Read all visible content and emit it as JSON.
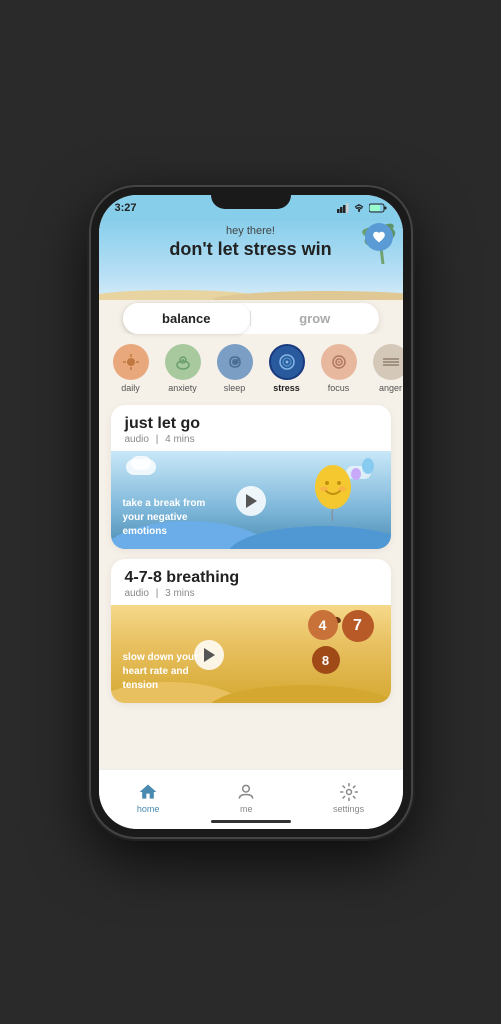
{
  "statusBar": {
    "time": "3:27",
    "signal": "▲▲",
    "wifi": "wifi",
    "battery": "battery"
  },
  "header": {
    "greeting": "hey there!",
    "title": "don't let stress win"
  },
  "tabs": [
    {
      "id": "balance",
      "label": "balance",
      "active": true
    },
    {
      "id": "grow",
      "label": "grow",
      "active": false
    }
  ],
  "categories": [
    {
      "id": "daily",
      "label": "daily",
      "active": false,
      "color": "#e8a87c",
      "emoji": "☀️"
    },
    {
      "id": "anxiety",
      "label": "anxiety",
      "active": false,
      "color": "#a8c89e",
      "emoji": "🫧"
    },
    {
      "id": "sleep",
      "label": "sleep",
      "active": false,
      "color": "#7b9ec4",
      "emoji": "🌙"
    },
    {
      "id": "stress",
      "label": "stress",
      "active": true,
      "color": "#4a7ab5",
      "emoji": "🌀"
    },
    {
      "id": "focus",
      "label": "focus",
      "active": false,
      "color": "#e8b89e",
      "emoji": "🎯"
    },
    {
      "id": "anger",
      "label": "anger",
      "active": false,
      "color": "#d4c8b8",
      "emoji": "〰️"
    }
  ],
  "cards": [
    {
      "id": "just-let-go",
      "title": "just let go",
      "type": "audio",
      "duration": "4 mins",
      "imageText": "take a break from\nyour negative\nemotions",
      "imageTheme": "blue"
    },
    {
      "id": "breathing",
      "title": "4-7-8 breathing",
      "type": "audio",
      "duration": "3 mins",
      "imageText": "slow down your\nheart rate and\ntension",
      "imageTheme": "yellow",
      "numbers": [
        "4",
        "7",
        "8"
      ]
    }
  ],
  "navigation": [
    {
      "id": "home",
      "label": "home",
      "icon": "🏠",
      "active": true
    },
    {
      "id": "me",
      "label": "me",
      "icon": "👤",
      "active": false
    },
    {
      "id": "settings",
      "label": "settings",
      "icon": "⚙️",
      "active": false
    }
  ],
  "colors": {
    "skyBlue": "#87CEEB",
    "accent": "#4a8ab0",
    "cardBg": "#ffffff",
    "pageBg": "#f5f0e8",
    "tabActive": "#222222",
    "tabInactive": "#aaaaaa"
  }
}
